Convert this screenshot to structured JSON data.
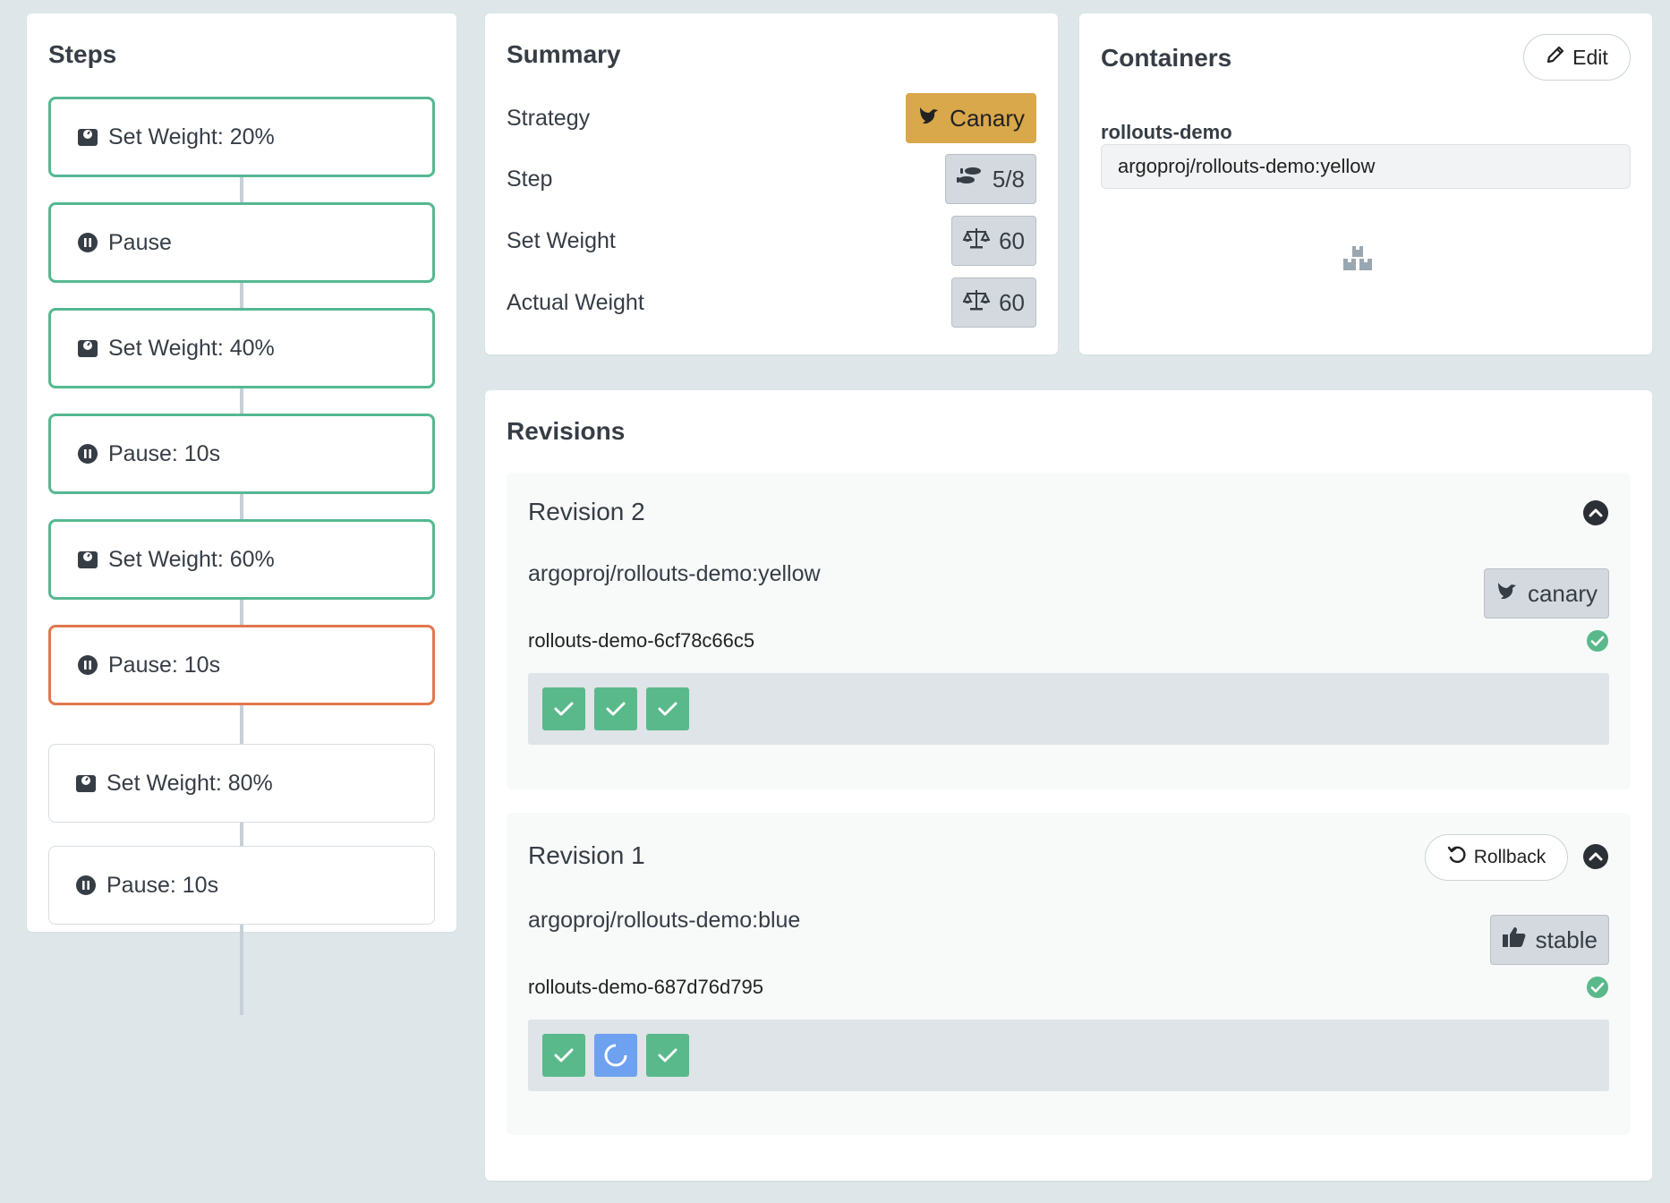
{
  "steps": {
    "title": "Steps",
    "items": [
      {
        "label": "Set Weight: 20%",
        "kind": "weight",
        "state": "complete"
      },
      {
        "label": "Pause",
        "kind": "pause",
        "state": "complete"
      },
      {
        "label": "Set Weight: 40%",
        "kind": "weight",
        "state": "complete"
      },
      {
        "label": "Pause: 10s",
        "kind": "pause",
        "state": "complete"
      },
      {
        "label": "Set Weight: 60%",
        "kind": "weight",
        "state": "complete"
      },
      {
        "label": "Pause: 10s",
        "kind": "pause",
        "state": "current"
      },
      {
        "label": "Set Weight: 80%",
        "kind": "weight",
        "state": "pending"
      },
      {
        "label": "Pause: 10s",
        "kind": "pause",
        "state": "pending"
      }
    ]
  },
  "summary": {
    "title": "Summary",
    "strategy_label": "Strategy",
    "strategy_value": "Canary",
    "step_label": "Step",
    "step_value": "5/8",
    "set_weight_label": "Set Weight",
    "set_weight_value": "60",
    "actual_weight_label": "Actual Weight",
    "actual_weight_value": "60"
  },
  "containers": {
    "title": "Containers",
    "edit_label": "Edit",
    "name": "rollouts-demo",
    "image": "argoproj/rollouts-demo:yellow"
  },
  "revisions": {
    "title": "Revisions",
    "items": [
      {
        "title": "Revision 2",
        "image": "argoproj/rollouts-demo:yellow",
        "badge": "canary",
        "replicaset": "rollouts-demo-6cf78c66c5",
        "pods": [
          "ok",
          "ok",
          "ok"
        ]
      },
      {
        "title": "Revision 1",
        "image": "argoproj/rollouts-demo:blue",
        "badge": "stable",
        "rollback_label": "Rollback",
        "replicaset": "rollouts-demo-687d76d795",
        "pods": [
          "ok",
          "progress",
          "ok"
        ]
      }
    ]
  },
  "colors": {
    "complete_border": "#55b892",
    "current_border": "#e1774d",
    "canary_badge": "#d9a84a",
    "pod_ok": "#5ab98b",
    "pod_progress": "#6ea1f0"
  }
}
